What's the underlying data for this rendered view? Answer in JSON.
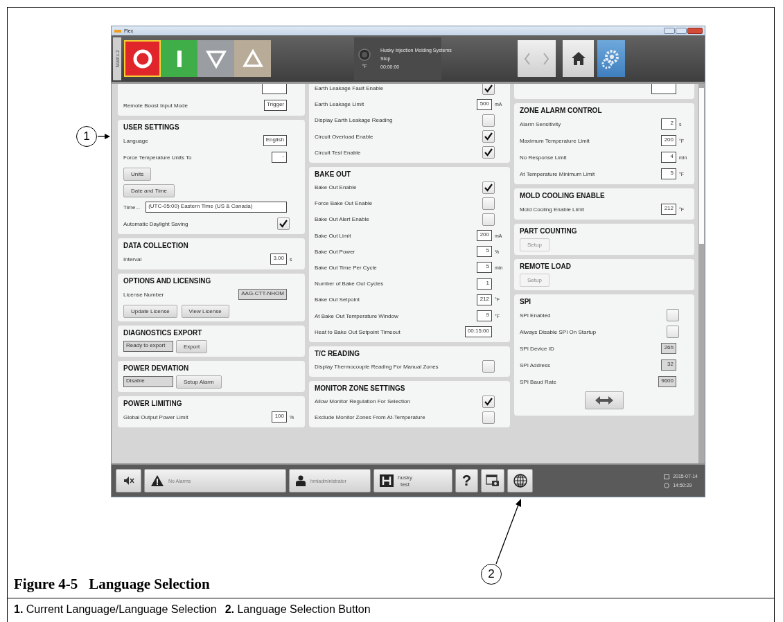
{
  "window": {
    "title": "Flex"
  },
  "toolbar": {
    "side_tab": "Matrix 2",
    "machine_buttons": [
      {
        "kind": "stop",
        "selected": true
      },
      {
        "kind": "start",
        "selected": false
      },
      {
        "kind": "down",
        "selected": false
      },
      {
        "kind": "up",
        "selected": false
      }
    ],
    "status": {
      "unit": "°F",
      "company": "Husky Injection Molding Systems",
      "state": "Stop",
      "timer": "00:00:00"
    }
  },
  "columns": [
    {
      "sections": [
        {
          "rows": [
            {
              "kind": "field"
            },
            {
              "kind": "field",
              "label": "Remote Boost Input Mode",
              "value": "Trigger"
            }
          ]
        },
        {
          "title": "USER SETTINGS",
          "rows": [
            {
              "kind": "field",
              "label": "Language",
              "value": "English"
            },
            {
              "kind": "field",
              "label": "Force Temperature Units To",
              "value": "-"
            },
            {
              "kind": "buttons",
              "buttons": [
                {
                  "label": "Units",
                  "disabled": false
                }
              ]
            },
            {
              "kind": "buttons",
              "buttons": [
                {
                  "label": "Date and Time",
                  "disabled": false
                }
              ]
            },
            {
              "kind": "wide_field",
              "label": "Time...",
              "value": "(UTC-05:00) Eastern Time (US & Canada)"
            },
            {
              "kind": "check",
              "label": "Automatic Daylight Saving",
              "checked": true
            }
          ]
        },
        {
          "title": "DATA COLLECTION",
          "rows": [
            {
              "kind": "field",
              "label": "Interval",
              "value": "3.00",
              "unit": "s"
            }
          ]
        },
        {
          "title": "OPTIONS AND LICENSING",
          "rows": [
            {
              "kind": "display",
              "label": "License Number",
              "value": "AAG-CTT-NHOM"
            },
            {
              "kind": "buttons",
              "buttons": [
                {
                  "label": "Update License",
                  "disabled": false
                },
                {
                  "label": "View License",
                  "disabled": false
                }
              ]
            }
          ]
        },
        {
          "title": "DIAGNOSTICS EXPORT",
          "rows": [
            {
              "kind": "display_button",
              "value": "Ready to export",
              "button": "Export"
            }
          ]
        },
        {
          "title": "POWER DEVIATION",
          "rows": [
            {
              "kind": "display_button",
              "value": "Disable",
              "button": "Setup Alarm"
            }
          ]
        },
        {
          "title": "POWER LIMITING",
          "rows": [
            {
              "kind": "field",
              "label": "Global Output Power Limit",
              "value": "100",
              "unit": "%"
            }
          ]
        }
      ]
    },
    {
      "sections": [
        {
          "rows": [
            {
              "kind": "check",
              "label": "Earth Leakage Fault Enable",
              "checked": true
            },
            {
              "kind": "field",
              "label": "Earth Leakage Limit",
              "value": "500",
              "unit": "mA"
            },
            {
              "kind": "check",
              "label": "Display Earth Leakage Reading",
              "checked": false
            },
            {
              "kind": "check",
              "label": "Circuit Overload Enable",
              "checked": true
            },
            {
              "kind": "check",
              "label": "Circuit Test Enable",
              "checked": true
            }
          ]
        },
        {
          "title": "BAKE OUT",
          "rows": [
            {
              "kind": "check",
              "label": "Bake Out Enable",
              "checked": true
            },
            {
              "kind": "check",
              "label": "Force Bake Out Enable",
              "checked": false
            },
            {
              "kind": "check",
              "label": "Bake Out Alert Enable",
              "checked": false
            },
            {
              "kind": "field",
              "label": "Bake Out Limit",
              "value": "200",
              "unit": "mA"
            },
            {
              "kind": "field",
              "label": "Bake Out Power",
              "value": "5",
              "unit": "%"
            },
            {
              "kind": "field",
              "label": "Bake Out Time Per Cycle",
              "value": "5",
              "unit": "min"
            },
            {
              "kind": "field",
              "label": "Number of Bake Out Cycles",
              "value": "1"
            },
            {
              "kind": "field",
              "label": "Bake Out Setpoint",
              "value": "212",
              "unit": "°F"
            },
            {
              "kind": "field",
              "label": "At Bake Out Temperature Window",
              "value": "9",
              "unit": "°F"
            },
            {
              "kind": "field",
              "label": "Heat to Bake Out Setpoint Timeout",
              "value": "00:15:00"
            }
          ]
        },
        {
          "title": "T/C READING",
          "rows": [
            {
              "kind": "check",
              "label": "Display Thermocouple Reading For Manual Zones",
              "checked": false
            }
          ]
        },
        {
          "title": "MONITOR ZONE SETTINGS",
          "rows": [
            {
              "kind": "check",
              "label": "Allow Monitor Regulation For Selection",
              "checked": true
            },
            {
              "kind": "check",
              "label": "Exclude Monitor Zones From At-Temperature",
              "checked": false
            }
          ]
        }
      ]
    },
    {
      "sections": [
        {
          "rows": [
            {
              "kind": "field"
            }
          ]
        },
        {
          "title": "ZONE ALARM CONTROL",
          "rows": [
            {
              "kind": "field",
              "label": "Alarm Sensitivity",
              "value": "2",
              "unit": "s"
            },
            {
              "kind": "field",
              "label": "Maximum Temperature Limit",
              "value": "200",
              "unit": "°F"
            },
            {
              "kind": "field",
              "label": "No Response Limit",
              "value": "4",
              "unit": "min"
            },
            {
              "kind": "field",
              "label": "At Temperature Minimum Limit",
              "value": "5",
              "unit": "°F"
            }
          ]
        },
        {
          "title": "MOLD COOLING ENABLE",
          "rows": [
            {
              "kind": "field",
              "label": "Mold Cooling Enable Limit",
              "value": "212",
              "unit": "°F"
            }
          ]
        },
        {
          "title": "PART COUNTING",
          "rows": [
            {
              "kind": "buttons",
              "buttons": [
                {
                  "label": "Setup",
                  "disabled": true
                }
              ]
            }
          ]
        },
        {
          "title": "REMOTE LOAD",
          "rows": [
            {
              "kind": "buttons",
              "buttons": [
                {
                  "label": "Setup",
                  "disabled": true
                }
              ]
            }
          ]
        },
        {
          "title": "SPI",
          "rows": [
            {
              "kind": "check",
              "label": "SPI Enabled",
              "checked": false
            },
            {
              "kind": "check",
              "label": "Always Disable SPI On Startup",
              "checked": false
            },
            {
              "kind": "display",
              "label": "SPI Device ID",
              "value": "26h"
            },
            {
              "kind": "display",
              "label": "SPI Address",
              "value": "32"
            },
            {
              "kind": "display",
              "label": "SPI Baud Rate",
              "value": "9600"
            },
            {
              "kind": "icon_button"
            }
          ]
        }
      ]
    }
  ],
  "status_bar": {
    "alarms": "No Alarms",
    "user": "hmiadministrator",
    "brand": "husky",
    "mold": "test",
    "help": "?",
    "date": "2015-07-14",
    "time": "14:50:29"
  },
  "callouts": [
    {
      "number": "1"
    },
    {
      "number": "2"
    }
  ],
  "caption": {
    "figure": "Figure 4-5",
    "title": "Language Selection"
  },
  "legend": [
    {
      "number": "1.",
      "text": "Current Language/Language Selection"
    },
    {
      "number": "2.",
      "text": "Language Selection Button"
    }
  ]
}
